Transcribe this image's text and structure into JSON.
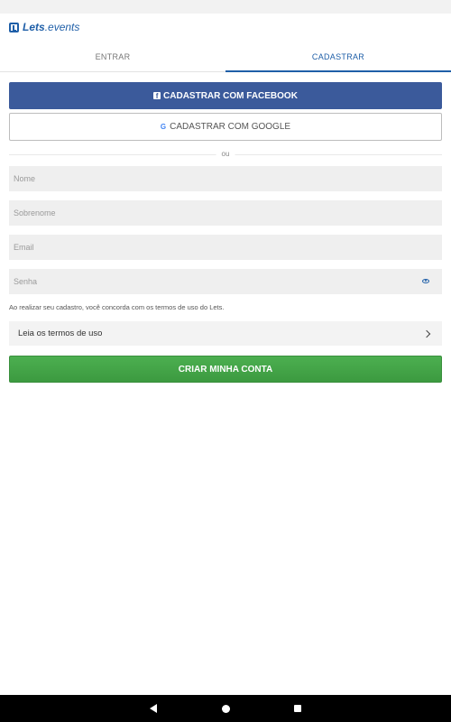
{
  "app": {
    "logo_bold": "Lets",
    "logo_rest": ".events"
  },
  "tabs": [
    {
      "label": "ENTRAR",
      "active": false
    },
    {
      "label": "CADASTRAR",
      "active": true
    }
  ],
  "social": {
    "facebook_label": "CADASTRAR COM FACEBOOK",
    "facebook_icon": "facebook-icon",
    "google_label": "CADASTRAR COM GOOGLE",
    "google_icon": "google-icon"
  },
  "divider_text": "ou",
  "form": {
    "nome": {
      "placeholder": "Nome",
      "value": ""
    },
    "sobrenome": {
      "placeholder": "Sobrenome",
      "value": ""
    },
    "email": {
      "placeholder": "Email",
      "value": ""
    },
    "senha": {
      "placeholder": "Senha",
      "value": ""
    }
  },
  "terms_note": "Ao realizar seu cadastro, você concorda com os termos de uso do Lets.",
  "terms_link": "Leia os termos de uso",
  "submit_label": "CRIAR MINHA CONTA",
  "colors": {
    "brand": "#1f5fa8",
    "facebook": "#3b5a9b",
    "submit": "#4caf50"
  },
  "nav_icons": [
    "back-icon",
    "home-icon",
    "recents-icon"
  ]
}
